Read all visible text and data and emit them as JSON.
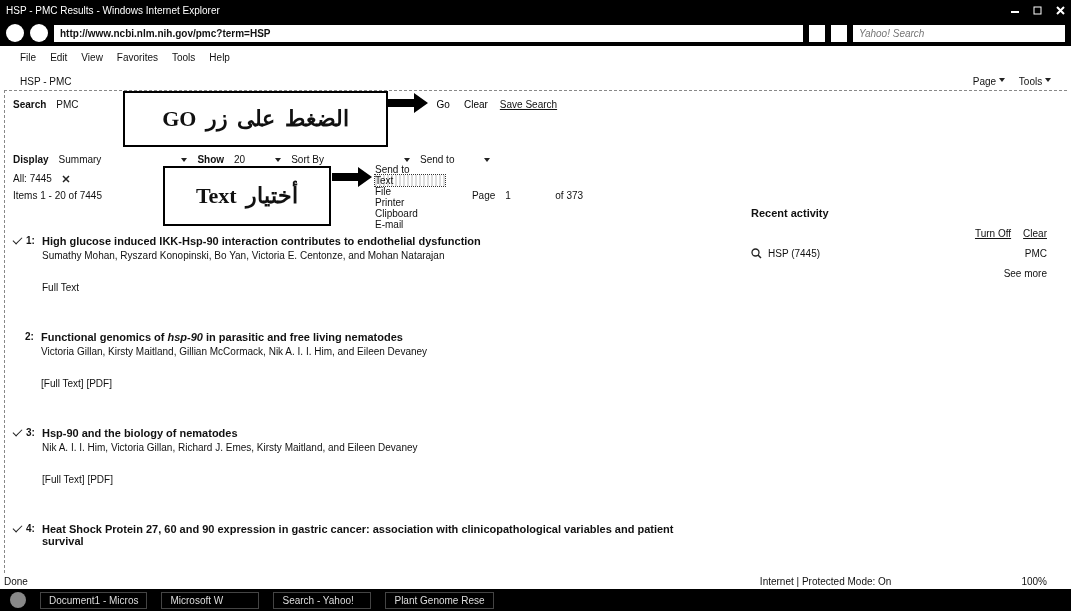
{
  "window": {
    "title": "HSP - PMC Results - Windows Internet Explorer"
  },
  "address": {
    "url": "http://www.ncbi.nlm.nih.gov/pmc?term=HSP",
    "search_placeholder": "Yahoo! Search"
  },
  "menu": [
    "File",
    "Edit",
    "View",
    "Favorites",
    "Tools",
    "Help"
  ],
  "tab": {
    "label": "HSP - PMC"
  },
  "command_bar": [
    "Page",
    "Tools"
  ],
  "search": {
    "label": "Search",
    "database": "PMC",
    "buttons": [
      "Go",
      "Clear"
    ],
    "save_link": "Save Search"
  },
  "display": {
    "label": "Display",
    "value": "Summary",
    "show_label": "Show",
    "show_value": "20",
    "sort": "Sort By",
    "send_to": "Send to"
  },
  "send_menu": [
    {
      "label": "Send to",
      "selected": false
    },
    {
      "label": "Text",
      "selected": true
    },
    {
      "label": "File",
      "selected": false
    },
    {
      "label": "Printer",
      "selected": false
    },
    {
      "label": "Clipboard",
      "selected": false
    },
    {
      "label": "E-mail",
      "selected": false
    }
  ],
  "filter": {
    "label": "All: 7445"
  },
  "items_info": "Items 1 - 20 of 7445",
  "pager": {
    "label": "Page",
    "value": "1",
    "total": "of 373"
  },
  "callouts": [
    "الضغط على زر GO",
    "أختيار Text"
  ],
  "results": [
    {
      "number": "1:",
      "checked": true,
      "title": "High glucose induced IKK-Hsp-90 interaction contributes to endothelial dysfunction",
      "authors": "Sumathy Mohan, Ryszard Konopinski, Bo Yan, Victoria E. Centonze, and Mohan Natarajan",
      "links": "Full Text"
    },
    {
      "number": "2:",
      "checked": false,
      "title": "Functional genomics of *hsp-90* in parasitic and free living nematodes",
      "authors": "Victoria Gillan, Kirsty Maitland, Gillian McCormack, Nik A. I. I. Him, and Eileen Devaney",
      "links": "[Full Text] [PDF]"
    },
    {
      "number": "3:",
      "checked": true,
      "title": "Hsp-90 and the biology of nematodes",
      "authors": "Nik A. I. I. Him, Victoria Gillan, Richard J. Emes, Kirsty Maitland, and Eileen Devaney",
      "links": "[Full Text] [PDF]"
    },
    {
      "number": "4:",
      "checked": true,
      "title": "Heat Shock Protein 27, 60 and 90 expression in gastric cancer: association with clinicopathological variables and patient survival"
    }
  ],
  "recent": {
    "title": "Recent activity",
    "actions": [
      "Turn Off",
      "Clear"
    ],
    "entry": "HSP (7445)",
    "entry_db": "PMC",
    "more": "See more"
  },
  "status": {
    "left": "Done",
    "zone": "Internet | Protected Mode: On",
    "zoom": "100%"
  },
  "taskbar": [
    "Document1 - Micros",
    "Microsoft W",
    "Search - Yahoo!",
    "Plant Genome Rese"
  ]
}
